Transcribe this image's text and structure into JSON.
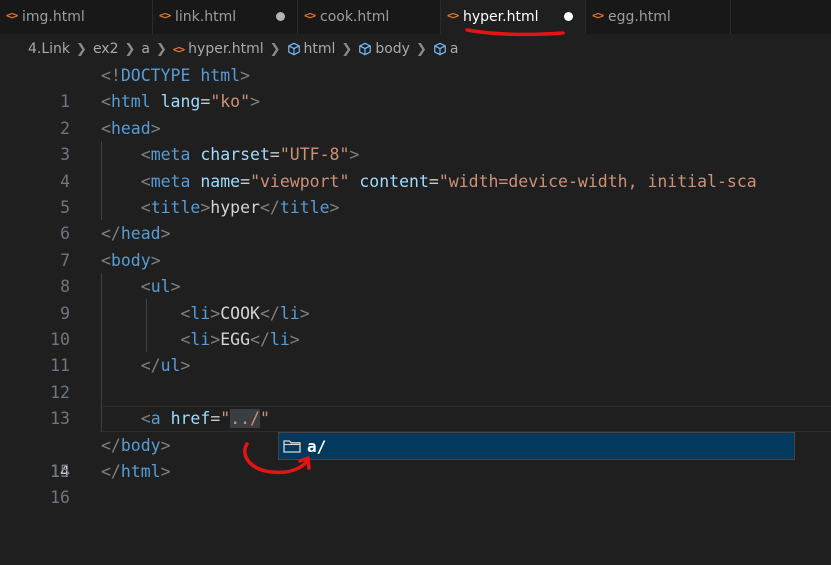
{
  "tabs": [
    {
      "label": "img.html",
      "modified": false,
      "active": false
    },
    {
      "label": "link.html",
      "modified": true,
      "active": false
    },
    {
      "label": "cook.html",
      "modified": false,
      "active": false
    },
    {
      "label": "hyper.html",
      "modified": true,
      "active": true
    },
    {
      "label": "egg.html",
      "modified": false,
      "active": false
    }
  ],
  "breadcrumb": {
    "folder1": "4.Link",
    "folder2": "ex2",
    "folder3": "a",
    "file": "hyper.html",
    "sym1": "html",
    "sym2": "body",
    "sym3": "a"
  },
  "editor": {
    "current_line": 14,
    "lines": [
      {
        "n": "1"
      },
      {
        "n": "2"
      },
      {
        "n": "3"
      },
      {
        "n": "4"
      },
      {
        "n": "5"
      },
      {
        "n": "6"
      },
      {
        "n": "7"
      },
      {
        "n": "8"
      },
      {
        "n": "9"
      },
      {
        "n": "10"
      },
      {
        "n": "11"
      },
      {
        "n": "12"
      },
      {
        "n": "13"
      },
      {
        "n": "14"
      },
      {
        "n": "15"
      },
      {
        "n": "16"
      }
    ],
    "code": {
      "doctype_kw": "DOCTYPE",
      "doctype_val": "html",
      "html": "html",
      "lang_attr": "lang",
      "lang_val": "\"ko\"",
      "head": "head",
      "meta": "meta",
      "charset_attr": "charset",
      "charset_val": "\"UTF-8\"",
      "name_attr": "name",
      "name_val": "\"viewport\"",
      "content_attr": "content",
      "content_val": "\"width=device-width, initial-sca",
      "title": "title",
      "title_text": "hyper",
      "body": "body",
      "ul": "ul",
      "li": "li",
      "li1_text": "COOK",
      "li2_text": "EGG",
      "a": "a",
      "href_attr": "href",
      "href_q1": "\"",
      "href_path": "../",
      "href_q2": "\""
    }
  },
  "suggest": {
    "items": [
      {
        "label": "a/",
        "icon": "folder-icon"
      }
    ]
  },
  "colors": {
    "tag": "#569cd6",
    "attribute": "#9cdcfe",
    "string": "#ce9178",
    "annotation": "#e51414"
  }
}
